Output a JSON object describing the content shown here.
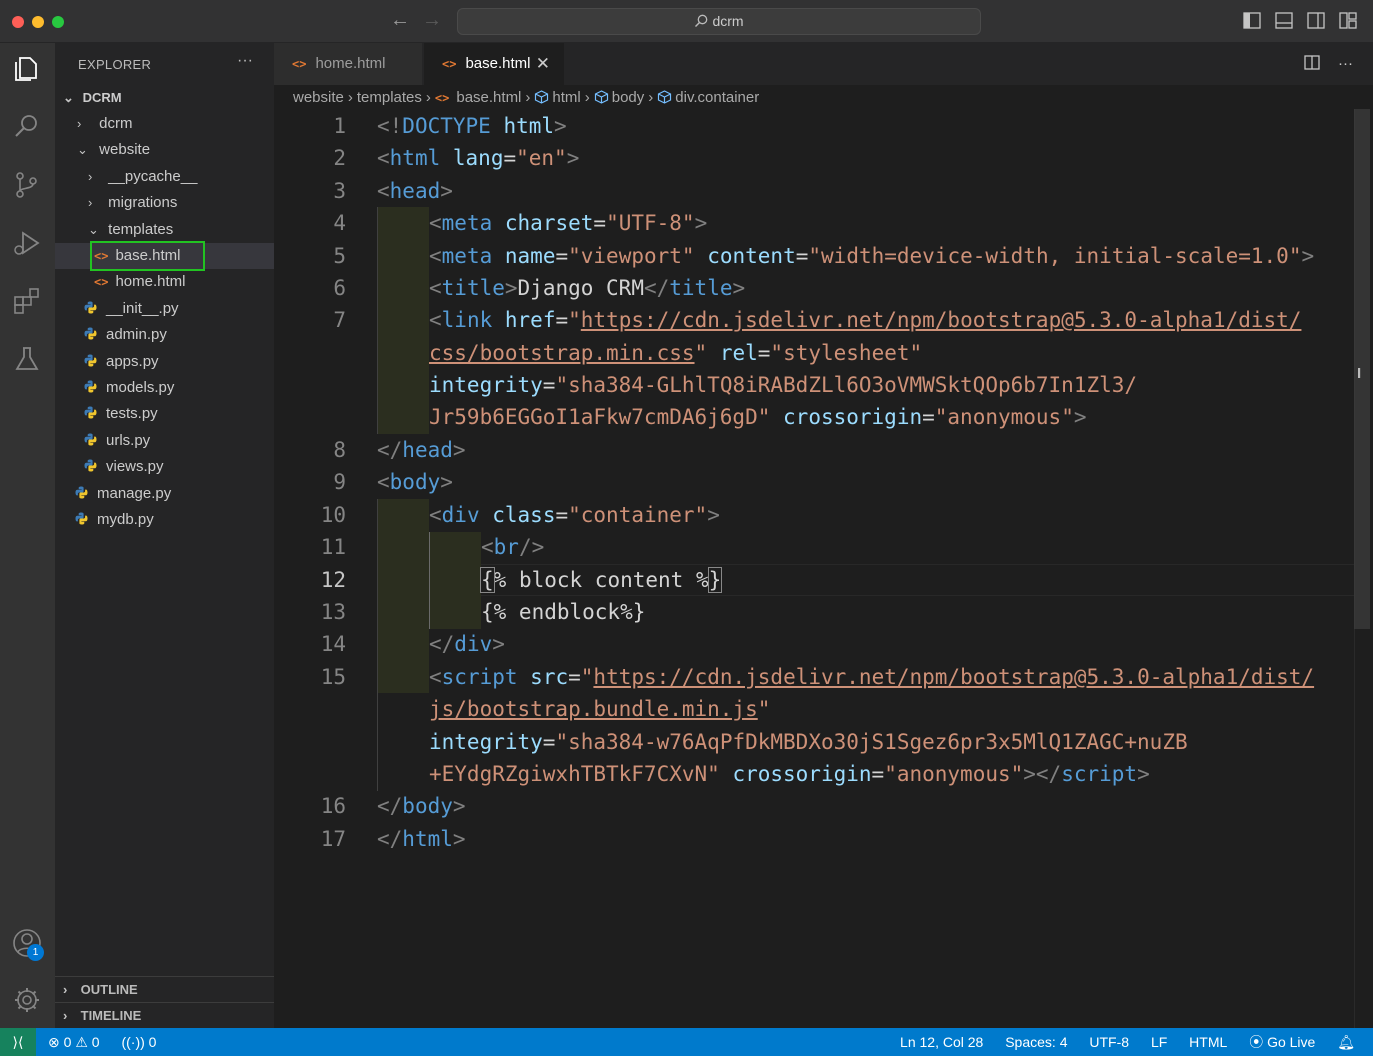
{
  "window": {
    "title": "dcrm"
  },
  "sidebar": {
    "header": "EXPLORER",
    "more": "···",
    "root": "DCRM",
    "items": [
      {
        "label": "dcrm",
        "kind": "folder",
        "expanded": false
      },
      {
        "label": "website",
        "kind": "folder",
        "expanded": true
      },
      {
        "label": "__pycache__",
        "kind": "folder",
        "expanded": false
      },
      {
        "label": "migrations",
        "kind": "folder",
        "expanded": false
      },
      {
        "label": "templates",
        "kind": "folder",
        "expanded": true
      },
      {
        "label": "base.html",
        "kind": "html",
        "selected": true
      },
      {
        "label": "home.html",
        "kind": "html"
      },
      {
        "label": "__init__.py",
        "kind": "python"
      },
      {
        "label": "admin.py",
        "kind": "python"
      },
      {
        "label": "apps.py",
        "kind": "python"
      },
      {
        "label": "models.py",
        "kind": "python"
      },
      {
        "label": "tests.py",
        "kind": "python"
      },
      {
        "label": "urls.py",
        "kind": "python"
      },
      {
        "label": "views.py",
        "kind": "python"
      },
      {
        "label": "manage.py",
        "kind": "python"
      },
      {
        "label": "mydb.py",
        "kind": "python"
      }
    ],
    "outline": "OUTLINE",
    "timeline": "TIMELINE",
    "accounts_badge": "1"
  },
  "tabs": [
    {
      "label": "home.html",
      "active": false
    },
    {
      "label": "base.html",
      "active": true
    }
  ],
  "breadcrumb": [
    "website",
    "templates",
    "base.html",
    "html",
    "body",
    "div.container"
  ],
  "editor": {
    "line_numbers": [
      "1",
      "2",
      "3",
      "4",
      "5",
      "6",
      "7",
      "8",
      "9",
      "10",
      "11",
      "12",
      "13",
      "14",
      "15",
      "16",
      "17"
    ],
    "current_line": "12"
  },
  "statusbar": {
    "errors": "0",
    "warnings": "0",
    "ports": "0",
    "position": "Ln 12, Col 28",
    "spaces": "Spaces: 4",
    "encoding": "UTF-8",
    "eol": "LF",
    "language": "HTML",
    "golive": "Go Live"
  },
  "colors": {
    "statusbar": "#007acc",
    "tag": "#569cd6",
    "attribute": "#9cdcfe",
    "string": "#ce9178",
    "highlight_box": "#22c322"
  }
}
